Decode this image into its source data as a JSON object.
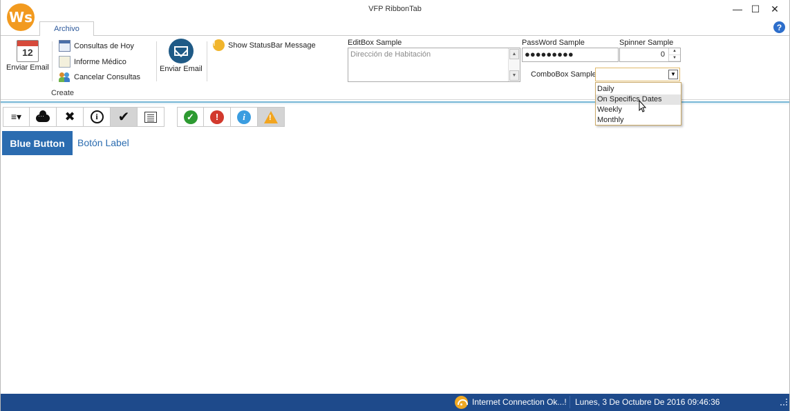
{
  "window": {
    "title": "VFP RibbonTab",
    "logo_text": "Ws",
    "minimize_glyph": "—",
    "maximize_glyph": "☐",
    "close_glyph": "✕"
  },
  "tabs": [
    {
      "label": "Archivo",
      "active": true
    }
  ],
  "help_glyph": "?",
  "ribbon": {
    "enviar_email_1": {
      "label": "Enviar Email",
      "icon": "calendar-icon",
      "calendar_number": "12"
    },
    "small_buttons": [
      {
        "label": "Consultas de Hoy",
        "icon": "calendar-small-icon"
      },
      {
        "label": "Informe Médico",
        "icon": "document-icon"
      },
      {
        "label": "Cancelar Consultas",
        "icon": "users-icon"
      }
    ],
    "group_label": "Create",
    "enviar_email_2": {
      "label": "Enviar Email",
      "icon": "mail-icon"
    },
    "statusbar_message": {
      "label": "Show StatusBar Message",
      "icon": "exclamation-icon",
      "glyph": "!"
    },
    "editbox": {
      "label": "EditBox Sample",
      "value": "Dirección de Habitación"
    },
    "password": {
      "label": "PassWord Sample",
      "value": "●●●●●●●●●"
    },
    "spinner": {
      "label": "Spinner Sample",
      "value": "0"
    },
    "combobox": {
      "label": "ComboBox Sample",
      "value": "",
      "options": [
        "Daily",
        "On Specifics Dates",
        "Weekly",
        "Monthly"
      ],
      "highlighted": "On Specifics Dates"
    }
  },
  "toolbar": {
    "group1": [
      {
        "name": "menu-icon",
        "glyph": "≡▾"
      },
      {
        "name": "cloud-icon"
      },
      {
        "name": "tools-icon",
        "glyph": "✖"
      },
      {
        "name": "info-outline-icon",
        "glyph": "i"
      },
      {
        "name": "checkmark-icon",
        "glyph": "✔",
        "active": true
      },
      {
        "name": "list-icon"
      }
    ],
    "group2": [
      {
        "name": "success-icon",
        "glyph": "✓"
      },
      {
        "name": "error-icon",
        "glyph": "!"
      },
      {
        "name": "info-icon",
        "glyph": "i"
      },
      {
        "name": "warning-icon",
        "glyph": "!",
        "active": true
      }
    ]
  },
  "content": {
    "blue_button": "Blue Button",
    "boton_label": "Botón Label"
  },
  "statusbar": {
    "connection": "Internet Connection Ok...!",
    "datetime": "Lunes, 3 De Octubre  De 2016 09:46:36"
  },
  "colors": {
    "accent_blue": "#2b6cb0",
    "statusbar_bg": "#1e4a8b",
    "logo_orange": "#f29a1f",
    "ribbon_line": "#71b4d4"
  }
}
